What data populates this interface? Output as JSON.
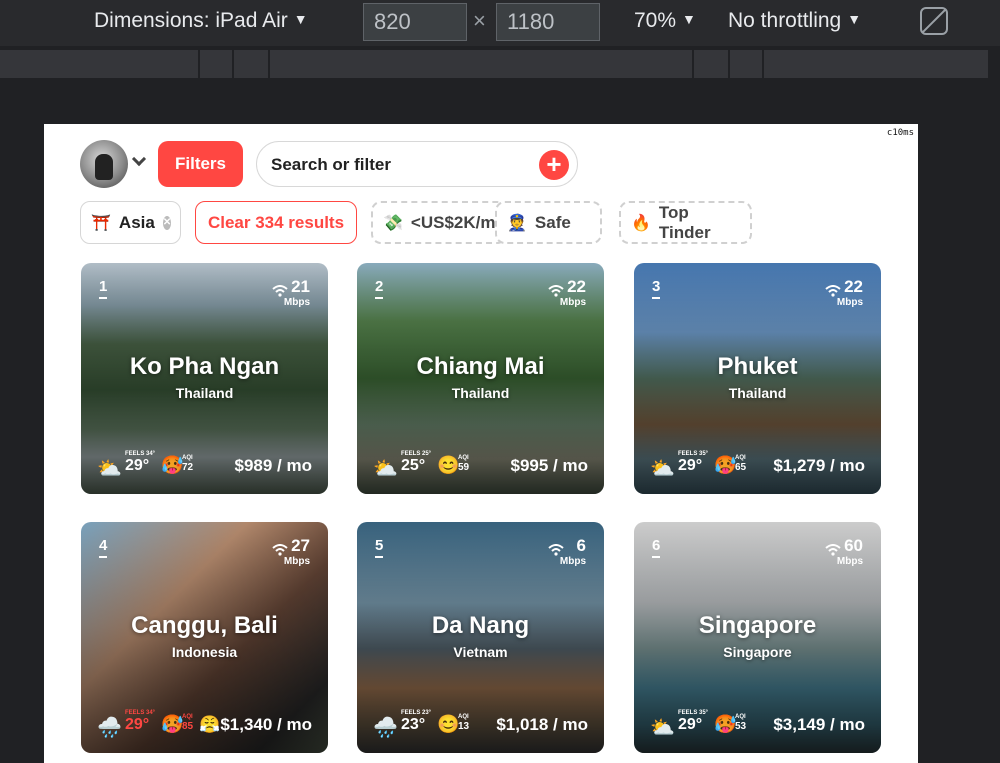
{
  "devtools": {
    "dimensions_label": "Dimensions: iPad Air",
    "width": "820",
    "height": "1180",
    "times": "×",
    "zoom": "70%",
    "throttling": "No throttling"
  },
  "app": {
    "perf_badge": "c10ms",
    "filters_label": "Filters",
    "search_placeholder": "Search or filter",
    "plus_symbol": "+"
  },
  "chips": {
    "asia": {
      "emoji": "⛩️",
      "label": "Asia"
    },
    "clear": {
      "label": "Clear 334 results"
    },
    "price": {
      "emoji": "💸",
      "label": "<US$2K/mo"
    },
    "safe": {
      "emoji": "👮",
      "label": "Safe"
    },
    "tinder": {
      "emoji": "🔥",
      "label": "Top Tinder"
    }
  },
  "cards": [
    {
      "rank": "1",
      "wifi": "21",
      "wifi_unit": "Mbps",
      "city": "Ko Pha Ngan",
      "country": "Thailand",
      "weather_icon": "⛅",
      "feels": "FEELS 34°",
      "temp": "29°",
      "aqi_face": "🥵",
      "aqi_label": "AQI",
      "aqi": "72",
      "price": "$989 / mo"
    },
    {
      "rank": "2",
      "wifi": "22",
      "wifi_unit": "Mbps",
      "city": "Chiang Mai",
      "country": "Thailand",
      "weather_icon": "⛅",
      "feels": "FEELS 25°",
      "temp": "25°",
      "aqi_face": "😊",
      "aqi_label": "AQI",
      "aqi": "59",
      "price": "$995 / mo"
    },
    {
      "rank": "3",
      "wifi": "22",
      "wifi_unit": "Mbps",
      "city": "Phuket",
      "country": "Thailand",
      "weather_icon": "⛅",
      "feels": "FEELS 35°",
      "temp": "29°",
      "aqi_face": "🥵",
      "aqi_label": "AQI",
      "aqi": "65",
      "price": "$1,279 / mo"
    },
    {
      "rank": "4",
      "wifi": "27",
      "wifi_unit": "Mbps",
      "city": "Canggu, Bali",
      "country": "Indonesia",
      "weather_icon": "🌧️",
      "feels": "FEELS 34°",
      "temp": "29°",
      "aqi_face": "🥵",
      "aqi_label": "AQI",
      "aqi": "85",
      "price": "😤$1,340 / mo"
    },
    {
      "rank": "5",
      "wifi": "6",
      "wifi_unit": "Mbps",
      "city": "Da Nang",
      "country": "Vietnam",
      "weather_icon": "🌧️",
      "feels": "FEELS 23°",
      "temp": "23°",
      "aqi_face": "😊",
      "aqi_label": "AQI",
      "aqi": "13",
      "price": "$1,018 / mo"
    },
    {
      "rank": "6",
      "wifi": "60",
      "wifi_unit": "Mbps",
      "city": "Singapore",
      "country": "Singapore",
      "weather_icon": "⛅",
      "feels": "FEELS 35°",
      "temp": "29°",
      "aqi_face": "🥵",
      "aqi_label": "AQI",
      "aqi": "53",
      "price": "$3,149 / mo"
    }
  ]
}
